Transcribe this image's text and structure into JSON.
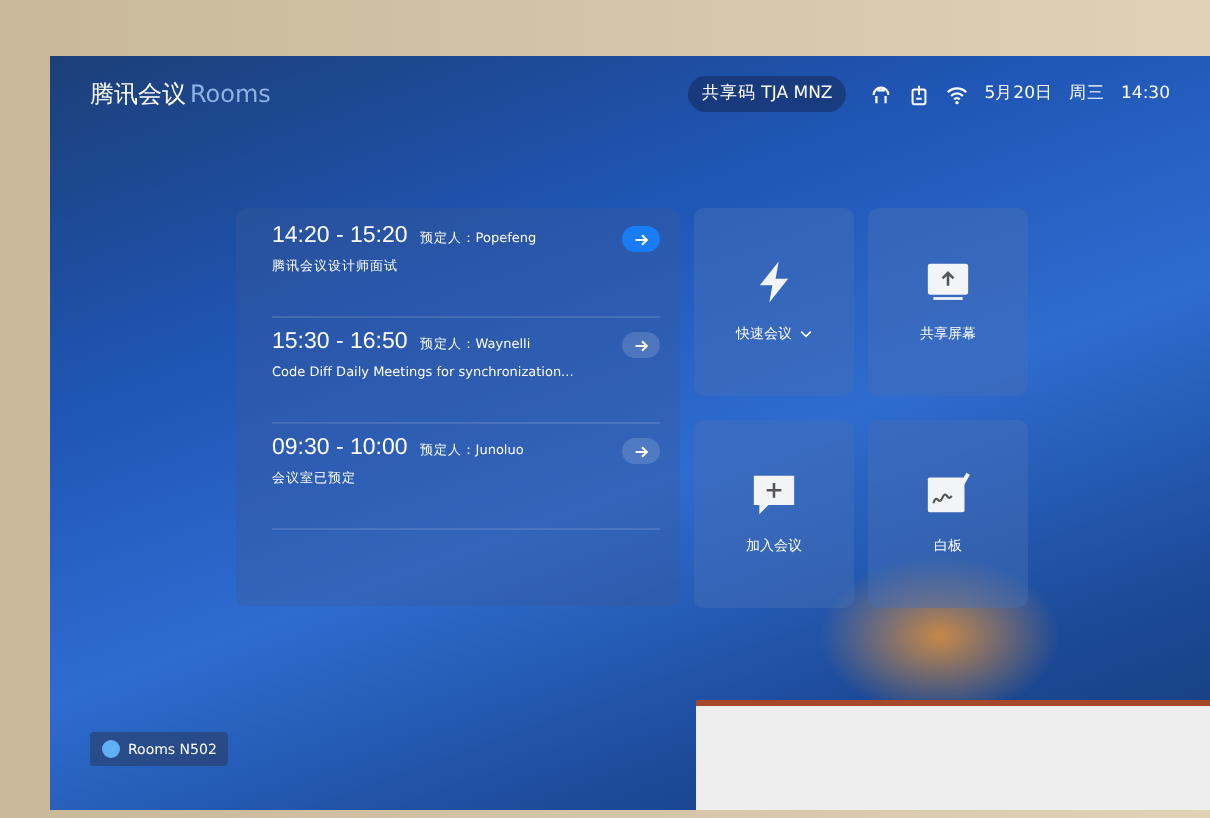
{
  "header": {
    "brand": "腾讯会议",
    "brand_suffix": "Rooms",
    "share_code": "共享码 TJA MNZ",
    "date": "5月20日",
    "weekday": "周三",
    "time": "14:30"
  },
  "meetings": [
    {
      "time": "14:20 - 15:20",
      "booker": "预定人：Popefeng",
      "title": "腾讯会议设计师面试",
      "active": true
    },
    {
      "time": "15:30 - 16:50",
      "booker": "预定人：Waynelli",
      "title": "Code Diff Daily Meetings for synchronization...",
      "active": false
    },
    {
      "time": "09:30 - 10:00",
      "booker": "预定人：Junoluo",
      "title": "会议室已预定",
      "active": false
    }
  ],
  "tiles": [
    {
      "kind": "quick",
      "label": "快速会议",
      "dropdown": true
    },
    {
      "kind": "share",
      "label": "共享屏幕",
      "dropdown": false
    },
    {
      "kind": "join",
      "label": "加入会议",
      "dropdown": false
    },
    {
      "kind": "whiteboard",
      "label": "白板",
      "dropdown": false
    }
  ],
  "room": {
    "name": "Rooms N502"
  }
}
